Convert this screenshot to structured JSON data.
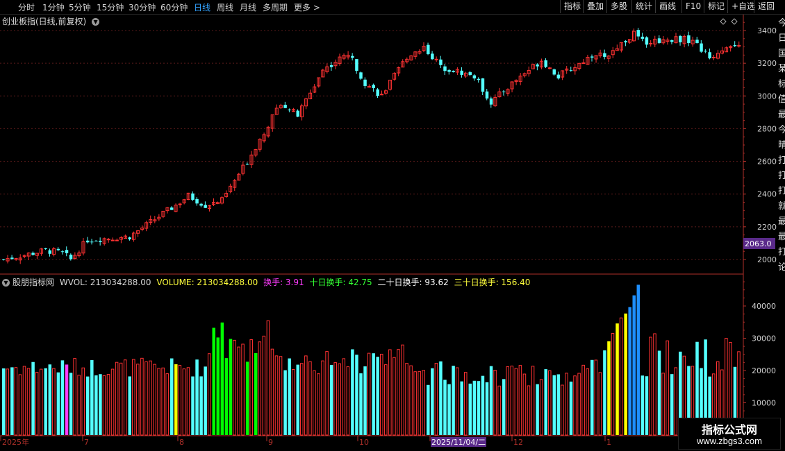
{
  "toolbar": {
    "periods": [
      "分时",
      "1分钟",
      "5分钟",
      "15分钟",
      "30分钟",
      "60分钟",
      "日线",
      "周线",
      "月线",
      "多周期",
      "更多 >"
    ],
    "active_period": "日线",
    "right_buttons": [
      "指标",
      "叠加",
      "多股",
      "统计",
      "画线",
      "F10",
      "标记",
      "+自选",
      "返回"
    ]
  },
  "price_panel": {
    "title": "创业板指(日线,前复权)",
    "y_ticks": [
      "3400",
      "3200",
      "3000",
      "2800",
      "2600",
      "2400",
      "2200",
      "2000"
    ],
    "current_label": "2063.0"
  },
  "volume_panel": {
    "indicator_name": "股朋指标网",
    "wvol_label": "WVOL: 213034288.00",
    "volume_label": "VOLUME: 213034288.00",
    "turnover_label": "换手: 3.91",
    "turn10_label": "十日换手: 42.75",
    "turn20_label": "二十日换手: 93.62",
    "turn30_label": "三十日换手: 156.40",
    "y_ticks": [
      "40000",
      "30000",
      "20000",
      "10000"
    ]
  },
  "x_axis": {
    "labels": [
      "2025年",
      "7",
      "8",
      "9",
      "10",
      "2025/11/04/二",
      "12",
      "1"
    ]
  },
  "side_text": [
    "今",
    "日",
    "国",
    "某",
    "标",
    "值",
    "最",
    "今",
    "晴",
    "打",
    "打",
    "打",
    "就",
    "最",
    "最",
    "打",
    "论"
  ],
  "logo": {
    "line1": "指标公式网",
    "line2": "www.zbgs3.com"
  },
  "colors": {
    "up": "#ff3232",
    "down": "#54ffff",
    "axis": "#b0302a",
    "active": "#33a3ff",
    "highlight_green": "#00ff00",
    "highlight_yellow": "#ffff00",
    "highlight_blue": "#1e8fff",
    "highlight_magenta": "#ff3cff"
  }
}
